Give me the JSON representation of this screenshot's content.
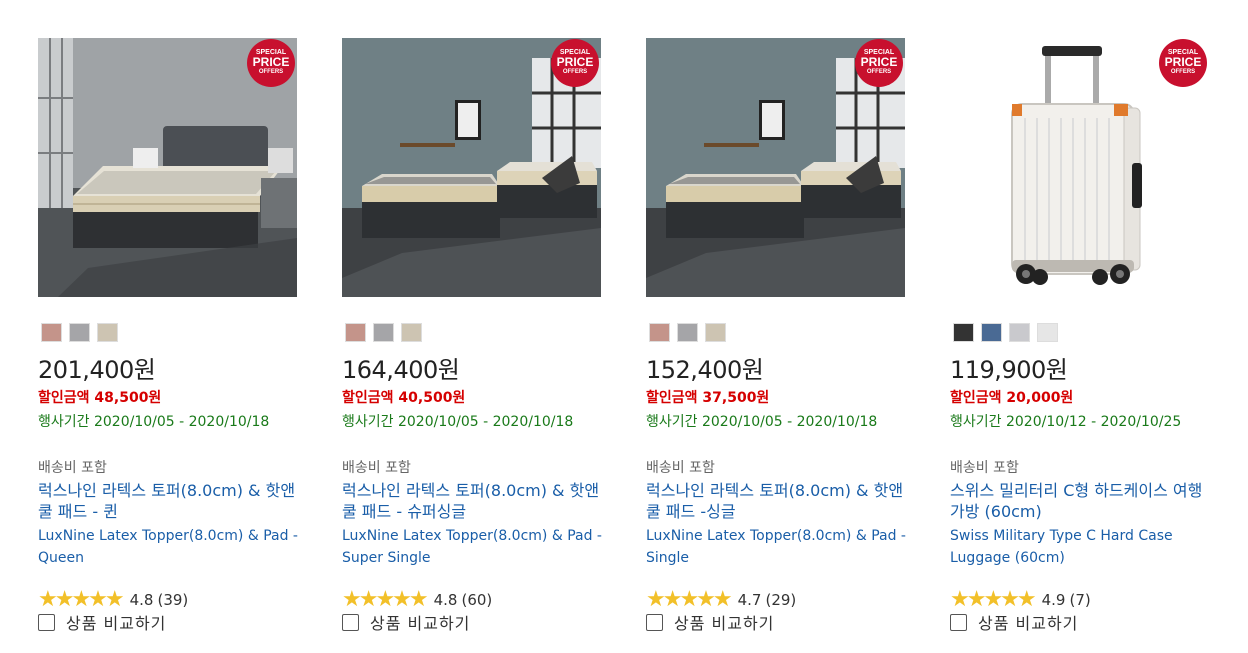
{
  "badge": {
    "line1": "SPECIAL",
    "line2": "PRICE",
    "line3": "OFFERS"
  },
  "products": [
    {
      "image": "mattress-topper-queen",
      "swatches": [
        "#c4948a",
        "#a5a5a8",
        "#cdc4b2"
      ],
      "price": "201,400원",
      "discount_label": "할인금액",
      "discount_value": "48,500원",
      "period": "행사기간 2020/10/05 - 2020/10/18",
      "shipping": "배송비 포함",
      "name_ko": "럭스나인 라텍스 토퍼(8.0cm) & 핫앤쿨 패드 - 퀸",
      "name_en": "LuxNine Latex Topper(8.0cm) & Pad -Queen",
      "stars": "★★★★★",
      "rating": "4.8",
      "reviews": "(39)",
      "compare": "상품 비교하기"
    },
    {
      "image": "mattress-topper-super-single",
      "swatches": [
        "#c4948a",
        "#a5a5a8",
        "#cdc4b2"
      ],
      "price": "164,400원",
      "discount_label": "할인금액",
      "discount_value": "40,500원",
      "period": "행사기간 2020/10/05 - 2020/10/18",
      "shipping": "배송비 포함",
      "name_ko": "럭스나인 라텍스 토퍼(8.0cm) & 핫앤쿨 패드 - 슈퍼싱글",
      "name_en": "LuxNine Latex Topper(8.0cm) & Pad -Super Single",
      "stars": "★★★★★",
      "rating": "4.8",
      "reviews": "(60)",
      "compare": "상품 비교하기"
    },
    {
      "image": "mattress-topper-single",
      "swatches": [
        "#c4948a",
        "#a5a5a8",
        "#cdc4b2"
      ],
      "price": "152,400원",
      "discount_label": "할인금액",
      "discount_value": "37,500원",
      "period": "행사기간 2020/10/05 - 2020/10/18",
      "shipping": "배송비 포함",
      "name_ko": "럭스나인 라텍스 토퍼(8.0cm) & 핫앤쿨 패드 -싱글",
      "name_en": "LuxNine Latex Topper(8.0cm) & Pad - Single",
      "stars": "★★★★★",
      "rating": "4.7",
      "reviews": "(29)",
      "compare": "상품 비교하기"
    },
    {
      "image": "white-hard-case-suitcase",
      "swatches": [
        "#333333",
        "#4a6a94",
        "#c9c9cd",
        "#e6e6e6"
      ],
      "price": "119,900원",
      "discount_label": "할인금액",
      "discount_value": "20,000원",
      "period": "행사기간 2020/10/12 - 2020/10/25",
      "shipping": "배송비 포함",
      "name_ko": "스위스 밀리터리 C형 하드케이스 여행가방 (60cm)",
      "name_en": "Swiss Military Type C Hard Case Luggage (60cm)",
      "stars": "★★★★★",
      "rating": "4.9",
      "reviews": "(7)",
      "compare": "상품 비교하기"
    }
  ]
}
